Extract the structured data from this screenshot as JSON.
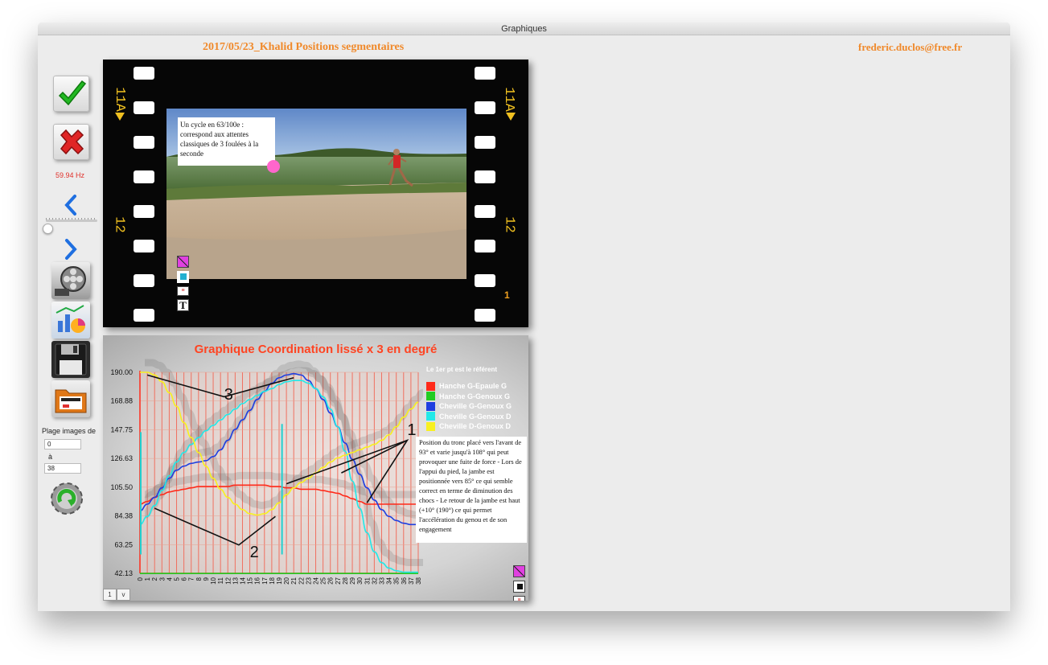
{
  "window": {
    "title": "Graphiques"
  },
  "header": {
    "title": "2017/05/23_Khalid Positions segmentaires",
    "email": "frederic.duclos@free.fr"
  },
  "sidebar": {
    "frequency": "59.94 Hz",
    "range_label": "Plage images de",
    "range_from": "0",
    "range_to_label": "à",
    "range_to": "38"
  },
  "film": {
    "marker_top": "11A",
    "marker_mid": "12",
    "frame_number": "1",
    "annotation": "Un cycle en 63/100e : correspond aux attentes classiques de 3 foulées à la seconde"
  },
  "chart_panel": {
    "note": "Position du tronc placé vers l'avant de 93° et varie jusqu'à 108° qui peut provoquer une fuite de force - Lors de l'appui du pied, la jambe est positionnée vers 85° ce qui semble correct en terme de diminution des chocs - Le retour de la jambe est haut (+10° (190°) ce qui permet l'accélération du genou et de son engagement",
    "annotation_labels": [
      "3",
      "2",
      "1"
    ],
    "pager": [
      "1",
      "v"
    ]
  },
  "colors": {
    "accent": "#f0892a",
    "chart_title": "#ff4422",
    "hz": "#e0302a"
  },
  "chart_data": {
    "type": "line",
    "title": "Graphique Coordination lissé x 3 en degré",
    "legend_note": "Le 1er pt est le référent",
    "x": [
      0,
      1,
      2,
      3,
      4,
      5,
      6,
      7,
      8,
      9,
      10,
      11,
      12,
      13,
      14,
      15,
      16,
      17,
      18,
      19,
      20,
      21,
      22,
      23,
      24,
      25,
      26,
      27,
      28,
      29,
      30,
      31,
      32,
      33,
      34,
      35,
      36,
      37,
      38
    ],
    "y_ticks": [
      "190.00",
      "168.88",
      "147.75",
      "126.63",
      "105.50",
      "84.38",
      "63.25",
      "42.13"
    ],
    "ylim": [
      42.13,
      190.0
    ],
    "series": [
      {
        "name": "Hanche G-Epaule G",
        "color": "#ff2a1a",
        "values": [
          93,
          95,
          98,
          100,
          102,
          103,
          104,
          105,
          106,
          106,
          106,
          106,
          106,
          107,
          107,
          107,
          107,
          107,
          106,
          106,
          105,
          105,
          104,
          104,
          104,
          103,
          102,
          101,
          99,
          97,
          95,
          93,
          93,
          93,
          93,
          93,
          93,
          93,
          93
        ]
      },
      {
        "name": "Hanche G-Genoux G",
        "color": "#22cc22",
        "values": [
          42,
          42,
          42,
          42,
          42,
          42,
          42,
          42,
          42,
          42,
          42,
          42,
          42,
          42,
          42,
          42,
          42,
          42,
          42,
          42,
          42,
          42,
          42,
          42,
          42,
          42,
          42,
          42,
          42,
          42,
          42,
          42,
          42,
          42,
          42,
          42,
          42,
          42,
          42
        ]
      },
      {
        "name": "Cheville G-Genoux G",
        "color": "#1f3fe0",
        "values": [
          88,
          93,
          98,
          105,
          112,
          118,
          121,
          123,
          124,
          125,
          128,
          133,
          140,
          148,
          155,
          162,
          170,
          176,
          182,
          186,
          188,
          189,
          188,
          184,
          178,
          170,
          160,
          150,
          138,
          126,
          115,
          105,
          96,
          89,
          84,
          81,
          79,
          78,
          78
        ]
      },
      {
        "name": "Cheville G-Genoux D",
        "color": "#22e8e8",
        "values": [
          78,
          84,
          92,
          103,
          114,
          124,
          131,
          137,
          142,
          147,
          151,
          155,
          159,
          163,
          167,
          170,
          173,
          176,
          178,
          181,
          183,
          184,
          184,
          182,
          178,
          172,
          163,
          150,
          132,
          110,
          90,
          72,
          58,
          50,
          46,
          44,
          43,
          43,
          43
        ]
      },
      {
        "name": "Cheville D-Genoux D",
        "color": "#f8f020",
        "values": [
          190,
          190,
          188,
          183,
          175,
          165,
          153,
          142,
          131,
          121,
          112,
          104,
          98,
          93,
          89,
          86,
          85,
          86,
          89,
          94,
          100,
          105,
          109,
          112,
          116,
          120,
          124,
          127,
          129,
          131,
          133,
          135,
          137,
          140,
          144,
          150,
          157,
          163,
          168
        ]
      }
    ]
  }
}
